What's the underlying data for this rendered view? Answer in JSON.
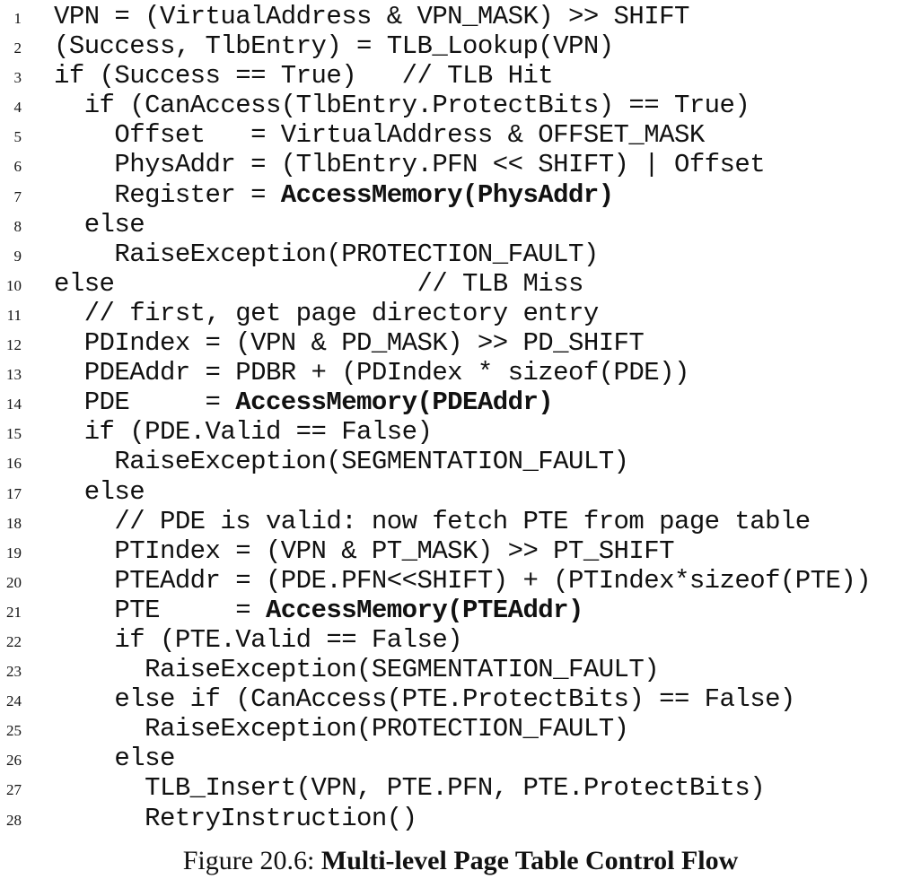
{
  "listing": {
    "lines": [
      {
        "n": "1",
        "segments": [
          {
            "t": "VPN = (VirtualAddress & VPN_MASK) >> SHIFT",
            "b": false
          }
        ]
      },
      {
        "n": "2",
        "segments": [
          {
            "t": "(Success, TlbEntry) = TLB_Lookup(VPN)",
            "b": false
          }
        ]
      },
      {
        "n": "3",
        "segments": [
          {
            "t": "if (Success == True)   // TLB Hit",
            "b": false
          }
        ]
      },
      {
        "n": "4",
        "segments": [
          {
            "t": "  if (CanAccess(TlbEntry.ProtectBits) == True)",
            "b": false
          }
        ]
      },
      {
        "n": "5",
        "segments": [
          {
            "t": "    Offset   = VirtualAddress & OFFSET_MASK",
            "b": false
          }
        ]
      },
      {
        "n": "6",
        "segments": [
          {
            "t": "    PhysAddr = (TlbEntry.PFN << SHIFT) | Offset",
            "b": false
          }
        ]
      },
      {
        "n": "7",
        "segments": [
          {
            "t": "    Register = ",
            "b": false
          },
          {
            "t": "AccessMemory(PhysAddr)",
            "b": true
          }
        ]
      },
      {
        "n": "8",
        "segments": [
          {
            "t": "  else",
            "b": false
          }
        ]
      },
      {
        "n": "9",
        "segments": [
          {
            "t": "    RaiseException(PROTECTION_FAULT)",
            "b": false
          }
        ]
      },
      {
        "n": "10",
        "segments": [
          {
            "t": "else                    // TLB Miss",
            "b": false
          }
        ]
      },
      {
        "n": "11",
        "segments": [
          {
            "t": "  // first, get page directory entry",
            "b": false
          }
        ]
      },
      {
        "n": "12",
        "segments": [
          {
            "t": "  PDIndex = (VPN & PD_MASK) >> PD_SHIFT",
            "b": false
          }
        ]
      },
      {
        "n": "13",
        "segments": [
          {
            "t": "  PDEAddr = PDBR + (PDIndex * sizeof(PDE))",
            "b": false
          }
        ]
      },
      {
        "n": "14",
        "segments": [
          {
            "t": "  PDE     = ",
            "b": false
          },
          {
            "t": "AccessMemory(PDEAddr)",
            "b": true
          }
        ]
      },
      {
        "n": "15",
        "segments": [
          {
            "t": "  if (PDE.Valid == False)",
            "b": false
          }
        ]
      },
      {
        "n": "16",
        "segments": [
          {
            "t": "    RaiseException(SEGMENTATION_FAULT)",
            "b": false
          }
        ]
      },
      {
        "n": "17",
        "segments": [
          {
            "t": "  else",
            "b": false
          }
        ]
      },
      {
        "n": "18",
        "segments": [
          {
            "t": "    // PDE is valid: now fetch PTE from page table",
            "b": false
          }
        ]
      },
      {
        "n": "19",
        "segments": [
          {
            "t": "    PTIndex = (VPN & PT_MASK) >> PT_SHIFT",
            "b": false
          }
        ]
      },
      {
        "n": "20",
        "segments": [
          {
            "t": "    PTEAddr = (PDE.PFN<<SHIFT) + (PTIndex*sizeof(PTE))",
            "b": false
          }
        ]
      },
      {
        "n": "21",
        "segments": [
          {
            "t": "    PTE     = ",
            "b": false
          },
          {
            "t": "AccessMemory(PTEAddr)",
            "b": true
          }
        ]
      },
      {
        "n": "22",
        "segments": [
          {
            "t": "    if (PTE.Valid == False)",
            "b": false
          }
        ]
      },
      {
        "n": "23",
        "segments": [
          {
            "t": "      RaiseException(SEGMENTATION_FAULT)",
            "b": false
          }
        ]
      },
      {
        "n": "24",
        "segments": [
          {
            "t": "    else if (CanAccess(PTE.ProtectBits) == False)",
            "b": false
          }
        ]
      },
      {
        "n": "25",
        "segments": [
          {
            "t": "      RaiseException(PROTECTION_FAULT)",
            "b": false
          }
        ]
      },
      {
        "n": "26",
        "segments": [
          {
            "t": "    else",
            "b": false
          }
        ]
      },
      {
        "n": "27",
        "segments": [
          {
            "t": "      TLB_Insert(VPN, PTE.PFN, PTE.ProtectBits)",
            "b": false
          }
        ]
      },
      {
        "n": "28",
        "segments": [
          {
            "t": "      RetryInstruction()",
            "b": false
          }
        ]
      }
    ]
  },
  "caption": {
    "label": "Figure 20.6:",
    "title": "Multi-level Page Table Control Flow"
  }
}
